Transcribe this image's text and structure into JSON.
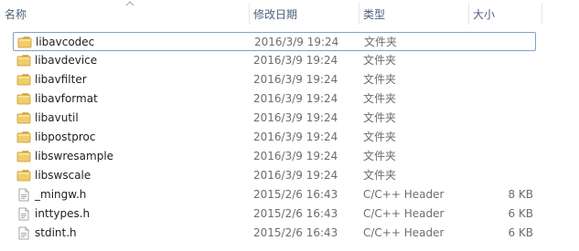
{
  "columns": {
    "name": "名称",
    "date": "修改日期",
    "type": "类型",
    "size": "大小"
  },
  "items": [
    {
      "name": "libavcodec",
      "date": "2016/3/9 19:24",
      "type": "文件夹",
      "size": "",
      "kind": "folder",
      "focused": true
    },
    {
      "name": "libavdevice",
      "date": "2016/3/9 19:24",
      "type": "文件夹",
      "size": "",
      "kind": "folder"
    },
    {
      "name": "libavfilter",
      "date": "2016/3/9 19:24",
      "type": "文件夹",
      "size": "",
      "kind": "folder"
    },
    {
      "name": "libavformat",
      "date": "2016/3/9 19:24",
      "type": "文件夹",
      "size": "",
      "kind": "folder"
    },
    {
      "name": "libavutil",
      "date": "2016/3/9 19:24",
      "type": "文件夹",
      "size": "",
      "kind": "folder"
    },
    {
      "name": "libpostproc",
      "date": "2016/3/9 19:24",
      "type": "文件夹",
      "size": "",
      "kind": "folder"
    },
    {
      "name": "libswresample",
      "date": "2016/3/9 19:24",
      "type": "文件夹",
      "size": "",
      "kind": "folder"
    },
    {
      "name": "libswscale",
      "date": "2016/3/9 19:24",
      "type": "文件夹",
      "size": "",
      "kind": "folder"
    },
    {
      "name": "_mingw.h",
      "date": "2015/2/6 16:43",
      "type": "C/C++ Header",
      "size": "8 KB",
      "kind": "file"
    },
    {
      "name": "inttypes.h",
      "date": "2015/2/6 16:43",
      "type": "C/C++ Header",
      "size": "6 KB",
      "kind": "file"
    },
    {
      "name": "stdint.h",
      "date": "2015/2/6 16:43",
      "type": "C/C++ Header",
      "size": "6 KB",
      "kind": "file"
    }
  ],
  "colors": {
    "header_text": "#4c607a",
    "focus_border": "#7da2ce",
    "folder": "#e8c25a",
    "secondary_text": "#6d6d6d"
  },
  "icons": {
    "folder": "folder-icon",
    "file": "header-file-icon",
    "sort": "sort-ascending-icon"
  }
}
